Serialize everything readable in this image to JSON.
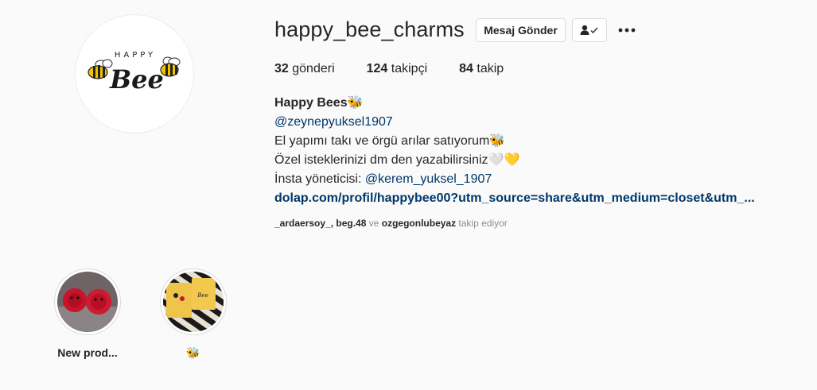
{
  "profile": {
    "username": "happy_bee_charms",
    "avatar": {
      "logo_text_top": "HAPPY",
      "logo_text_main": "Bee",
      "icon": "bee-logo-icon"
    },
    "message_button_label": "Mesaj Gönder",
    "follow_icon": "person-check-icon",
    "more_icon": "more-dots-icon"
  },
  "stats": {
    "posts_count": "32",
    "posts_label": " gönderi",
    "followers_count": "124",
    "followers_label": " takipçi",
    "following_count": "84",
    "following_label": " takip"
  },
  "bio": {
    "name": "Happy Bees🐝",
    "mention": "@zeynepyuksel1907",
    "line1": "El yapımı takı ve örgü arılar satıyorum🐝",
    "line2": "Özel isteklerinizi dm den yazabilirsiniz🤍💛",
    "manager_prefix": "İnsta yöneticisi: ",
    "manager_mention": "@kerem_yuksel_1907",
    "url": "dolap.com/profil/happybee00?utm_source=share&utm_medium=closet&utm_..."
  },
  "followed_by": {
    "user1": "_ardaersoy_",
    "sep1": ", ",
    "user2": "beg.48",
    "and_text": " ve ",
    "user3": "ozgegonlubeyaz",
    "suffix": " takip ediyor"
  },
  "highlights": [
    {
      "label": "New prod..."
    },
    {
      "label": "🐝"
    }
  ],
  "colors": {
    "background": "#fafafa",
    "link": "#00376b",
    "muted": "#8e8e8e",
    "border": "#dbdbdb",
    "bee_yellow": "#f2c200"
  }
}
